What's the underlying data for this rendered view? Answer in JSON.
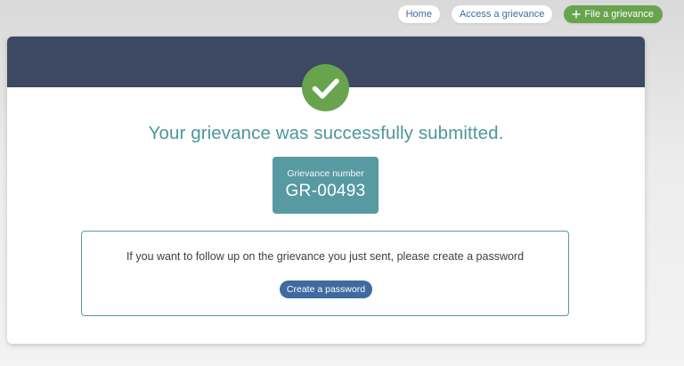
{
  "nav": {
    "home_label": "Home",
    "access_label": "Access a grievance",
    "file_label": "File a grievance"
  },
  "icons": {
    "success": "check-circle-icon",
    "add": "plus-icon"
  },
  "confirmation": {
    "title": "Your grievance was successfully submitted.",
    "number_label": "Grievance number",
    "number_value": "GR-00493"
  },
  "followup": {
    "message": "If you want to follow up on the grievance you just sent, please create a password",
    "button_label": "Create a password"
  },
  "colors": {
    "header": "#3d4963",
    "success_green": "#68a34e",
    "teal": "#579aa2",
    "title_teal": "#4d979b",
    "button_blue": "#3f6a9f",
    "link_blue": "#3d6d9e"
  }
}
